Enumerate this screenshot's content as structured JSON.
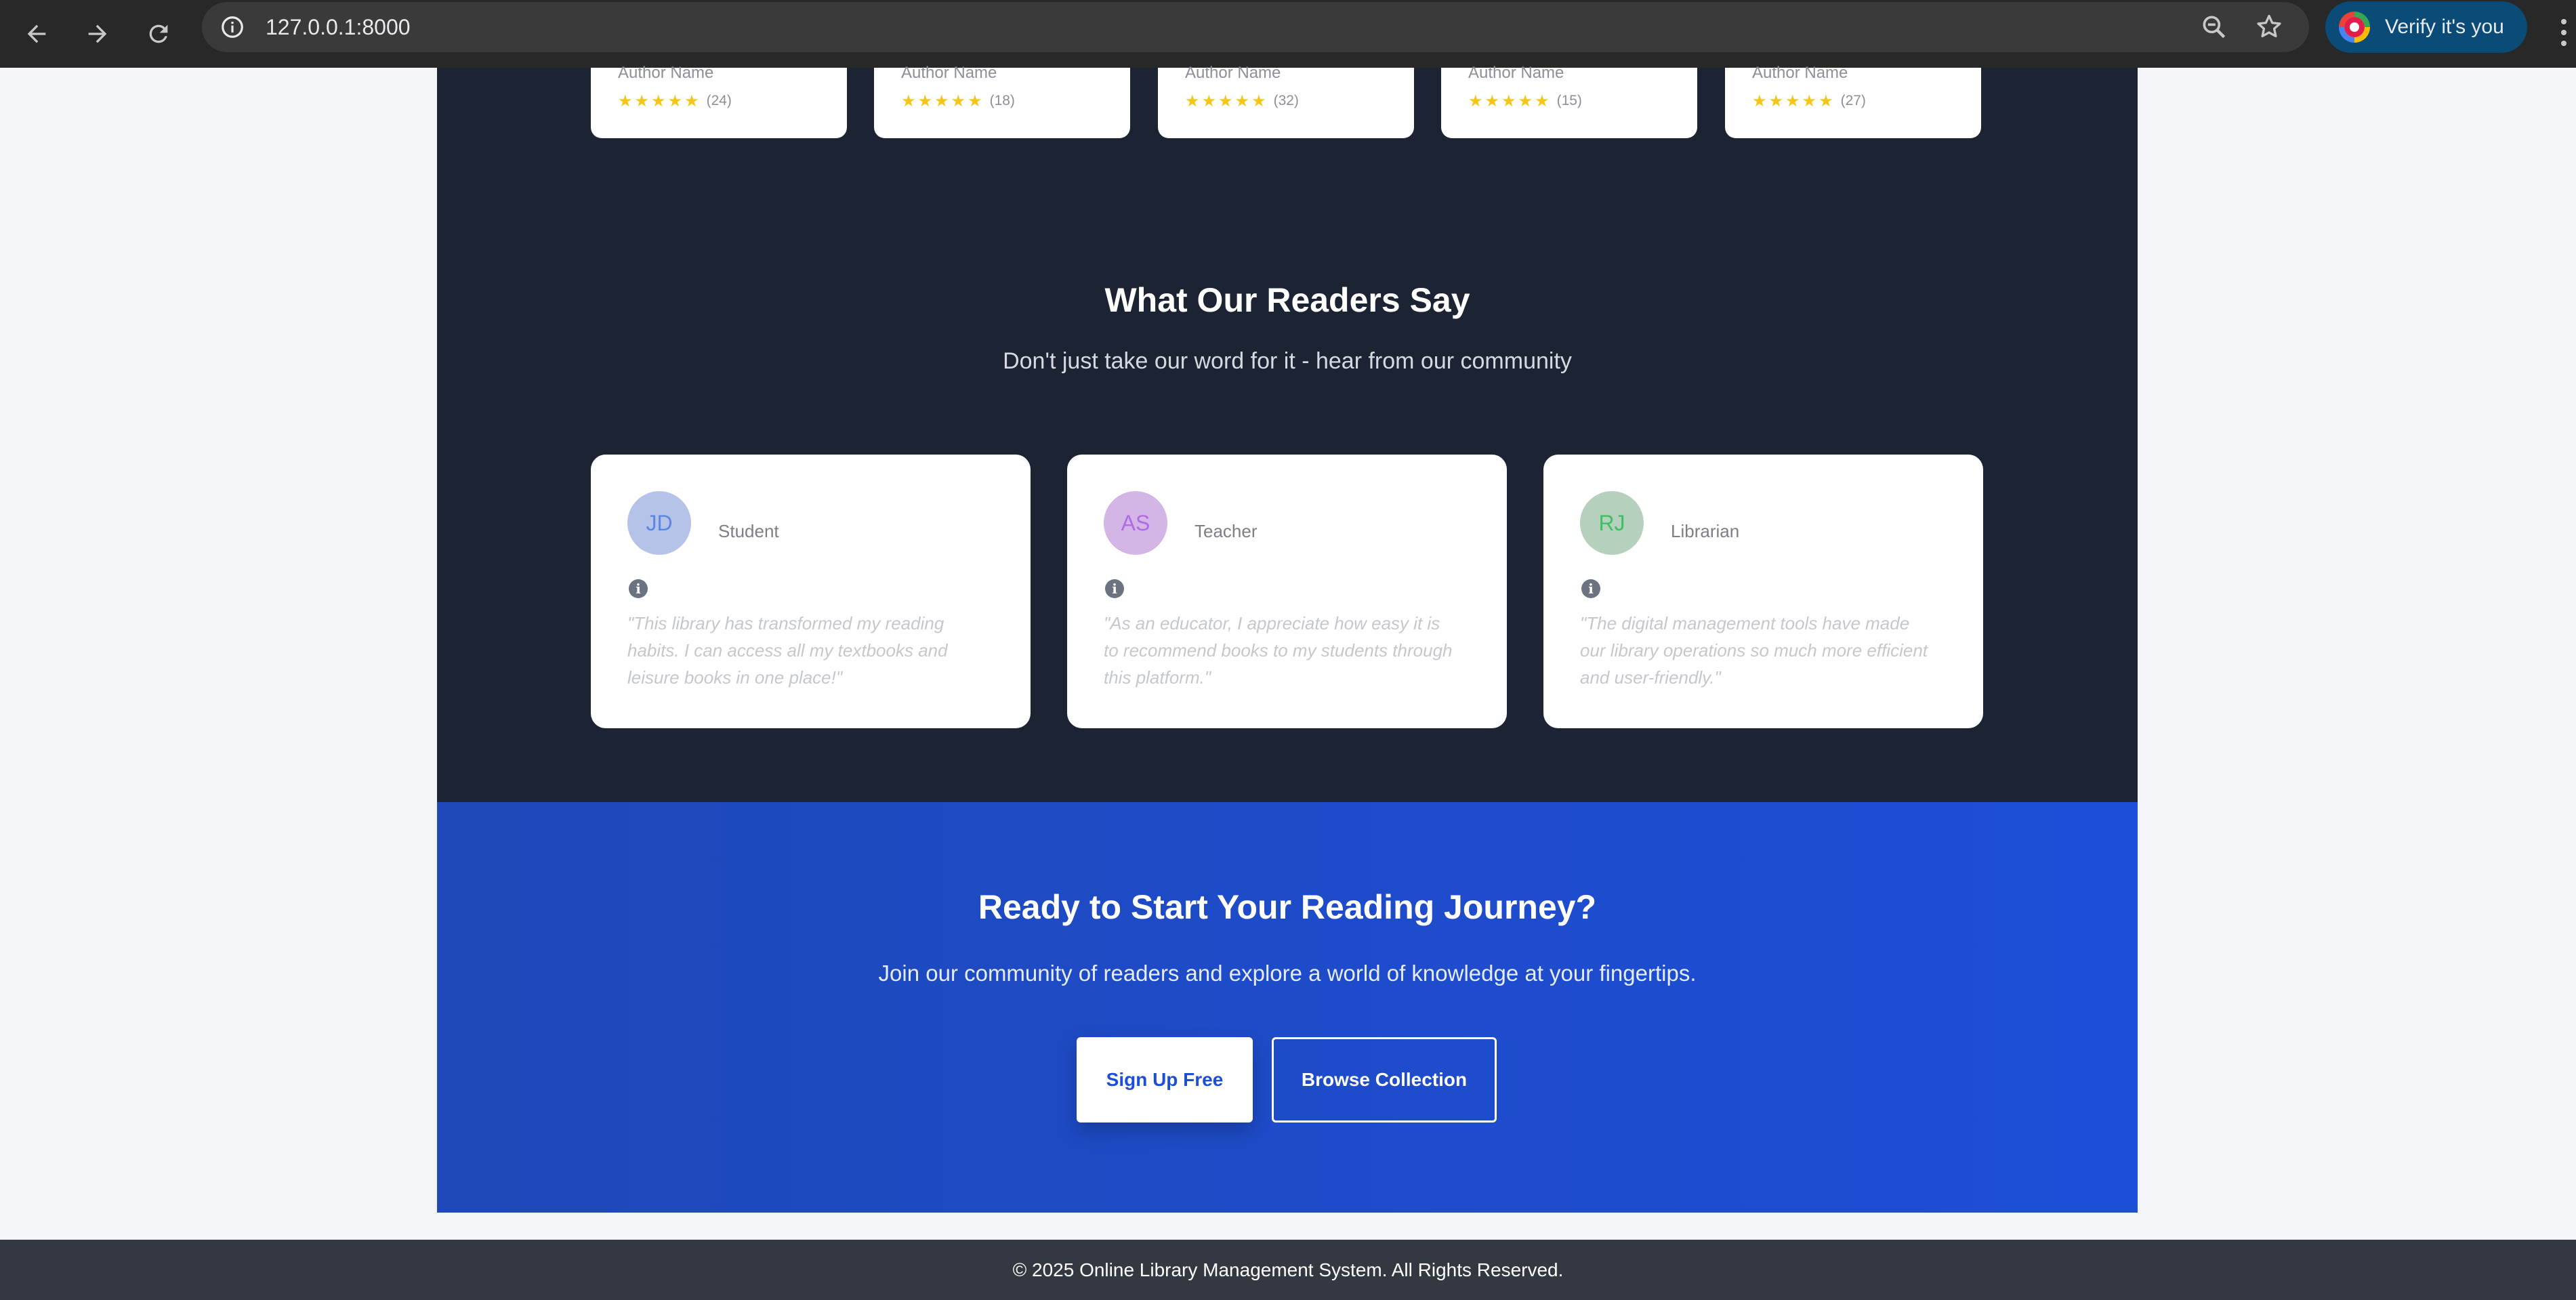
{
  "browser": {
    "url": "127.0.0.1:8000",
    "verify_label": "Verify it's you",
    "icons": [
      "back-arrow-icon",
      "forward-arrow-icon",
      "reload-icon",
      "site-info-icon",
      "zoom-icon",
      "bookmark-star-icon",
      "profile-icon",
      "more-vert-icon"
    ]
  },
  "books": [
    {
      "author": "Author Name",
      "rating": 5,
      "reviews": "(24)"
    },
    {
      "author": "Author Name",
      "rating": 5,
      "reviews": "(18)"
    },
    {
      "author": "Author Name",
      "rating": 5,
      "reviews": "(32)"
    },
    {
      "author": "Author Name",
      "rating": 5,
      "reviews": "(15)"
    },
    {
      "author": "Author Name",
      "rating": 5,
      "reviews": "(27)"
    }
  ],
  "testimonials": {
    "title": "What Our Readers Say",
    "subtitle": "Don't just take our word for it - hear from our community",
    "items": [
      {
        "initials": "JD",
        "role": "Student",
        "quote": "\"This library has transformed my reading habits. I can access all my textbooks and leisure books in one place!\"",
        "avatar_bg": "#b6c3e8",
        "avatar_fg": "#5b86e5"
      },
      {
        "initials": "AS",
        "role": "Teacher",
        "quote": "\"As an educator, I appreciate how easy it is to recommend books to my students through this platform.\"",
        "avatar_bg": "#d3b6e6",
        "avatar_fg": "#b06ae6"
      },
      {
        "initials": "RJ",
        "role": "Librarian",
        "quote": "\"The digital management tools have made our library operations so much more efficient and user-friendly.\"",
        "avatar_bg": "#b5d1bd",
        "avatar_fg": "#3fbf64"
      }
    ]
  },
  "cta": {
    "title": "Ready to Start Your Reading Journey?",
    "subtitle": "Join our community of readers and explore a world of knowledge at your fingertips.",
    "primary_label": "Sign Up Free",
    "secondary_label": "Browse Collection"
  },
  "footer": {
    "text": "© 2025 Online Library Management System. All Rights Reserved."
  },
  "colors": {
    "dark_bg": "#1c2434",
    "cta_bg": "#1d4ed8",
    "star": "#f5c518",
    "footer_bg": "#343840"
  }
}
